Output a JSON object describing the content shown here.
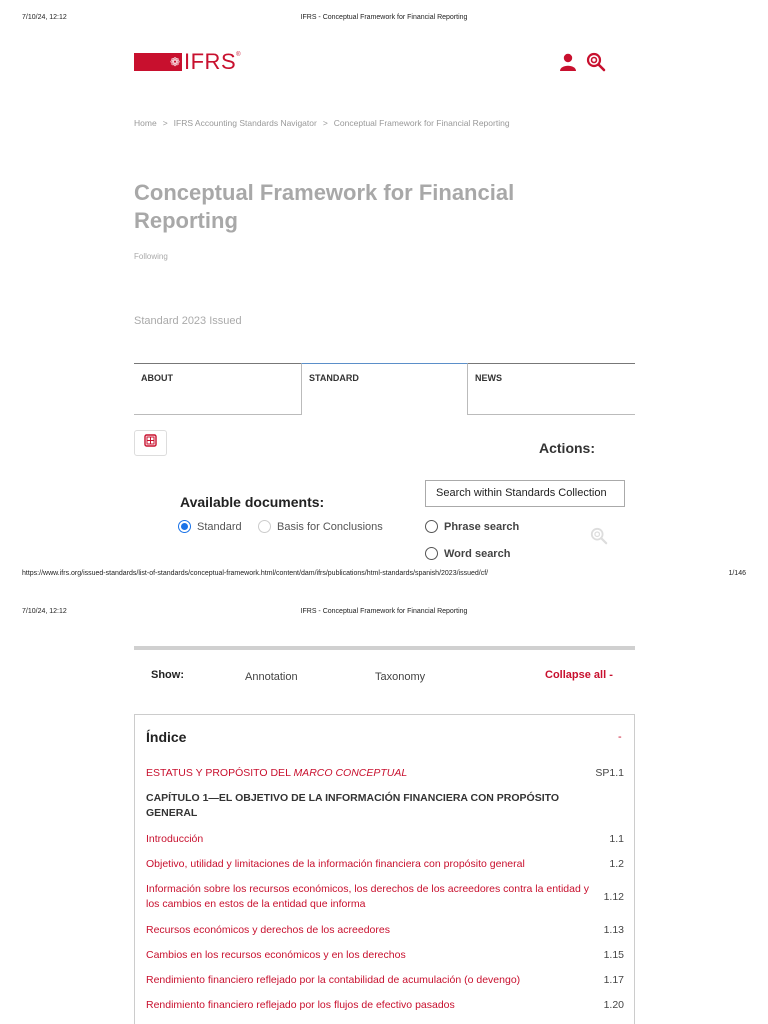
{
  "print": {
    "date": "7/10/24, 12:12",
    "doc_title": "IFRS - Conceptual Framework for Financial Reporting",
    "url": "https://www.ifrs.org/issued-standards/list-of-standards/conceptual-framework.html/content/dam/ifrs/publications/html-standards/spanish/2023/issued/cf/",
    "page_number": "1/146"
  },
  "header": {
    "logo_text": "IFRS",
    "logo_tm": "®",
    "user_icon": "user-icon",
    "search_icon": "search-icon",
    "brand_color": "#c8102e"
  },
  "breadcrumb": {
    "items": [
      "Home",
      "IFRS Accounting Standards Navigator",
      "Conceptual Framework for Financial Reporting"
    ],
    "separator": ">"
  },
  "page": {
    "title": "Conceptual Framework for Financial Reporting",
    "following": "Following",
    "status": "Standard 2023 Issued"
  },
  "tabs": [
    {
      "label": "ABOUT"
    },
    {
      "label": "STANDARD",
      "active": true
    },
    {
      "label": "NEWS"
    }
  ],
  "actions": {
    "pdf_icon": "pdf-icon",
    "label": "Actions:"
  },
  "documents": {
    "label": "Available documents:",
    "options": [
      {
        "label": "Standard",
        "checked": true
      },
      {
        "label": "Basis for Conclusions",
        "checked": false
      }
    ]
  },
  "search": {
    "placeholder": "Search within Standards Collection",
    "options": [
      {
        "label": "Phrase search"
      },
      {
        "label": "Word search"
      }
    ]
  },
  "show": {
    "label": "Show:",
    "annotation": "Annotation",
    "taxonomy": "Taxonomy",
    "collapse_all": "Collapse all -"
  },
  "index": {
    "title": "Índice",
    "collapse": "-",
    "rows": [
      {
        "text_pre": "ESTATUS Y PROPÓSITO DEL ",
        "text_em": "MARCO CONCEPTUAL",
        "ref": "SP1.1"
      },
      {
        "text": "CAPÍTULO 1—EL OBJETIVO DE LA INFORMACIÓN FINANCIERA CON PROPÓSITO GENERAL",
        "ref": ""
      },
      {
        "text": "Introducción",
        "ref": "1.1"
      },
      {
        "text": "Objetivo, utilidad y limitaciones de la información financiera con propósito general",
        "ref": "1.2"
      },
      {
        "text": "Información sobre los recursos económicos, los derechos de los acreedores contra la entidad y los cambios en estos de la entidad que informa",
        "ref": "1.12"
      },
      {
        "text": "Recursos económicos y derechos de los acreedores",
        "ref": "1.13"
      },
      {
        "text": "Cambios en los recursos económicos y en los derechos",
        "ref": "1.15"
      },
      {
        "text": "Rendimiento financiero reflejado por la contabilidad de acumulación (o devengo)",
        "ref": "1.17"
      },
      {
        "text": "Rendimiento financiero reflejado por los flujos de efectivo pasados",
        "ref": "1.20"
      }
    ]
  }
}
